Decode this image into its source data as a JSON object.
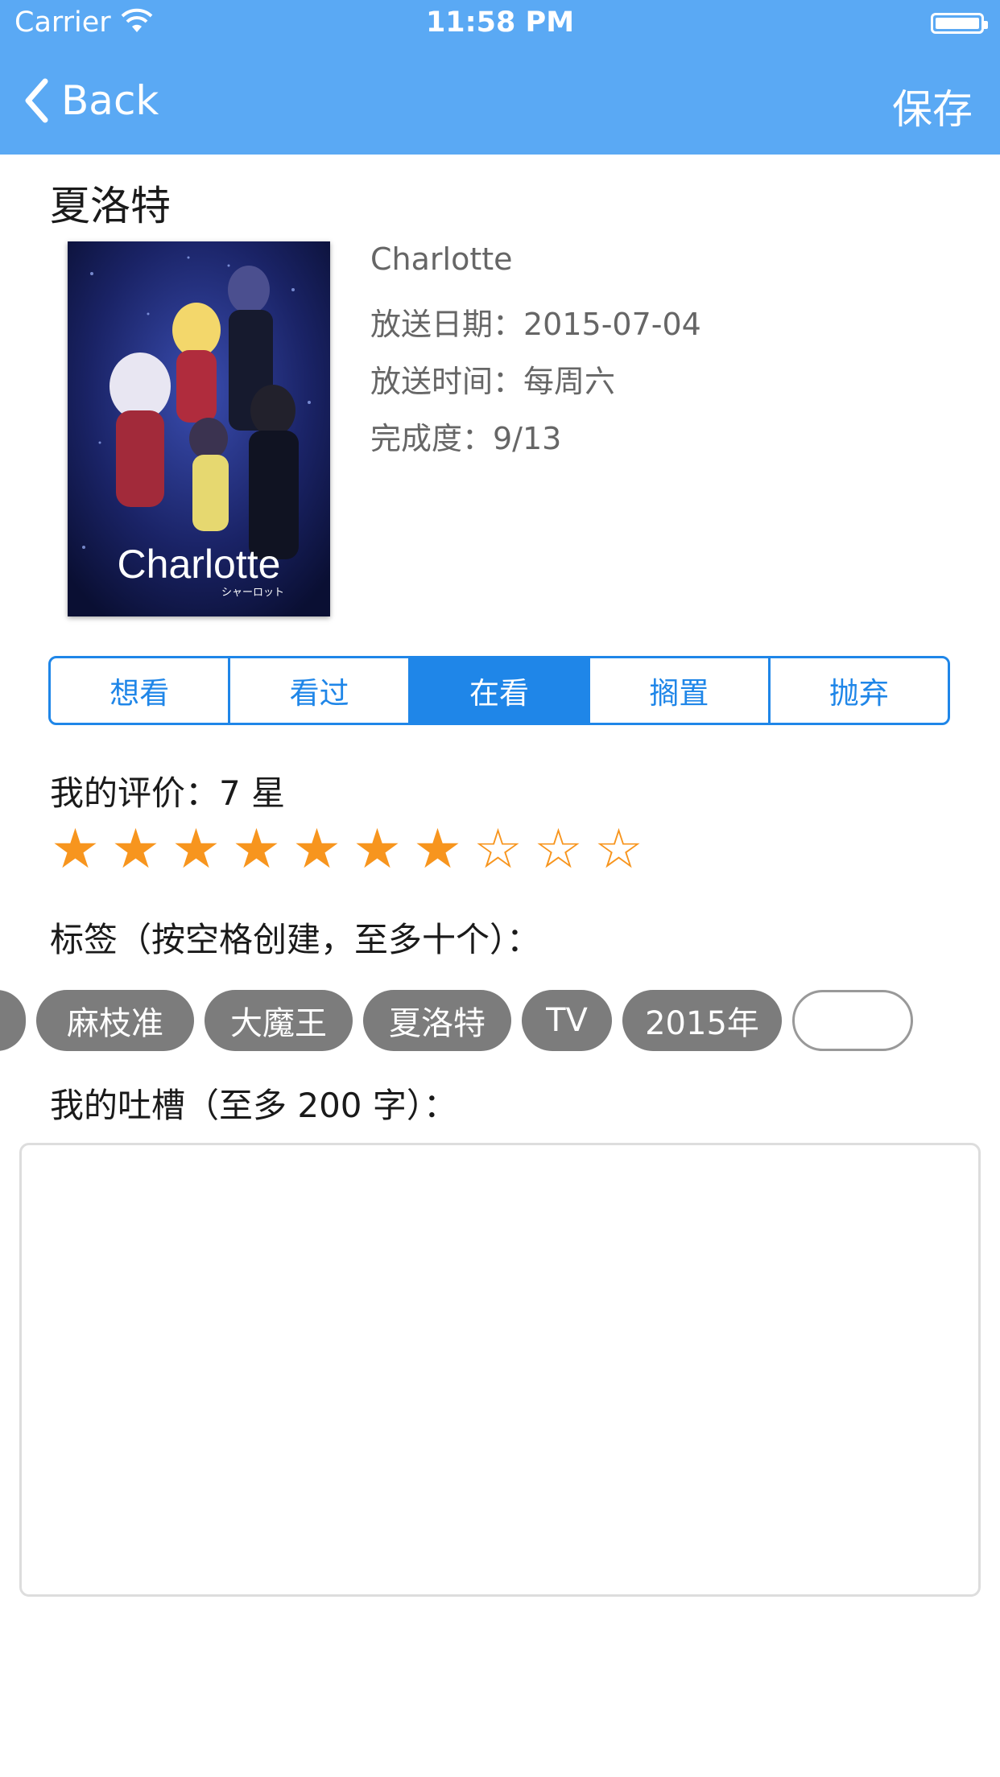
{
  "status_bar": {
    "carrier": "Carrier",
    "time": "11:58 PM"
  },
  "nav": {
    "back_label": "Back",
    "save_label": "保存",
    "bg_color": "#5aa9f4"
  },
  "anime": {
    "title_cn": "夏洛特",
    "title_en": "Charlotte",
    "air_date": "放送日期：2015-07-04",
    "air_time": "放送时间：每周六",
    "progress": "完成度：9/13",
    "poster_logo": "Charlotte",
    "poster_sub": "シャーロット"
  },
  "status_segments": {
    "options": [
      "想看",
      "看过",
      "在看",
      "搁置",
      "抛弃"
    ],
    "selected": "在看",
    "accent_color": "#1f86e8"
  },
  "rating": {
    "label": "我的评价：7 星",
    "value": 7,
    "max": 10,
    "star_color": "#f7951e"
  },
  "tags": {
    "label": "标签（按空格创建，至多十个）：",
    "items": [
      "麻枝准",
      "大魔王",
      "夏洛特",
      "TV",
      "2015年"
    ]
  },
  "comment": {
    "label": "我的吐槽（至多 200 字）：",
    "value": ""
  }
}
